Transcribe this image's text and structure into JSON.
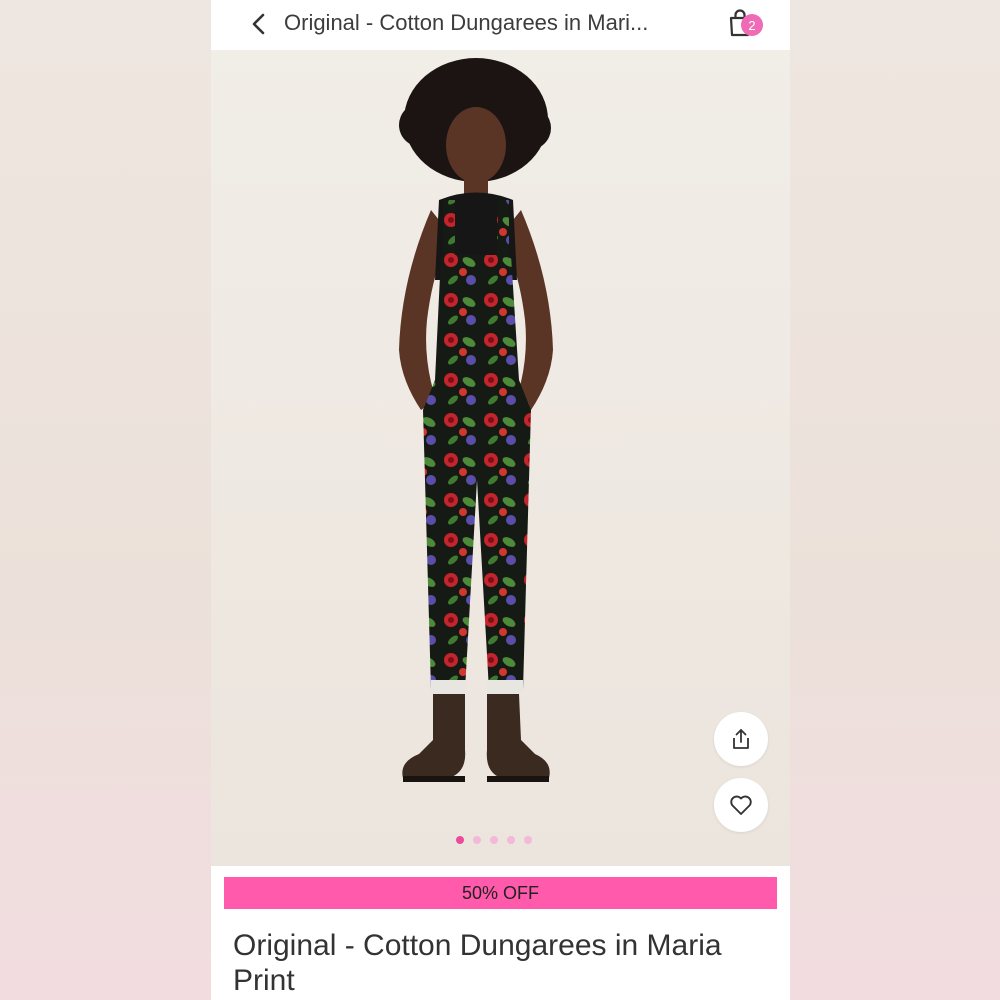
{
  "header": {
    "title": "Original - Cotton Dungarees in Mari...",
    "cart_count": "2"
  },
  "gallery": {
    "image_count": 5,
    "active_index": 0
  },
  "promo": {
    "label": "50% OFF",
    "color": "#ff5aab"
  },
  "product": {
    "title": "Original - Cotton Dungarees in Maria Print"
  },
  "colors": {
    "accent": "#ec4b9b",
    "badge": "#f06bb5"
  },
  "icons": {
    "back": "chevron-left-icon",
    "cart": "shopping-bag-icon",
    "share": "share-icon",
    "favorite": "heart-icon"
  }
}
